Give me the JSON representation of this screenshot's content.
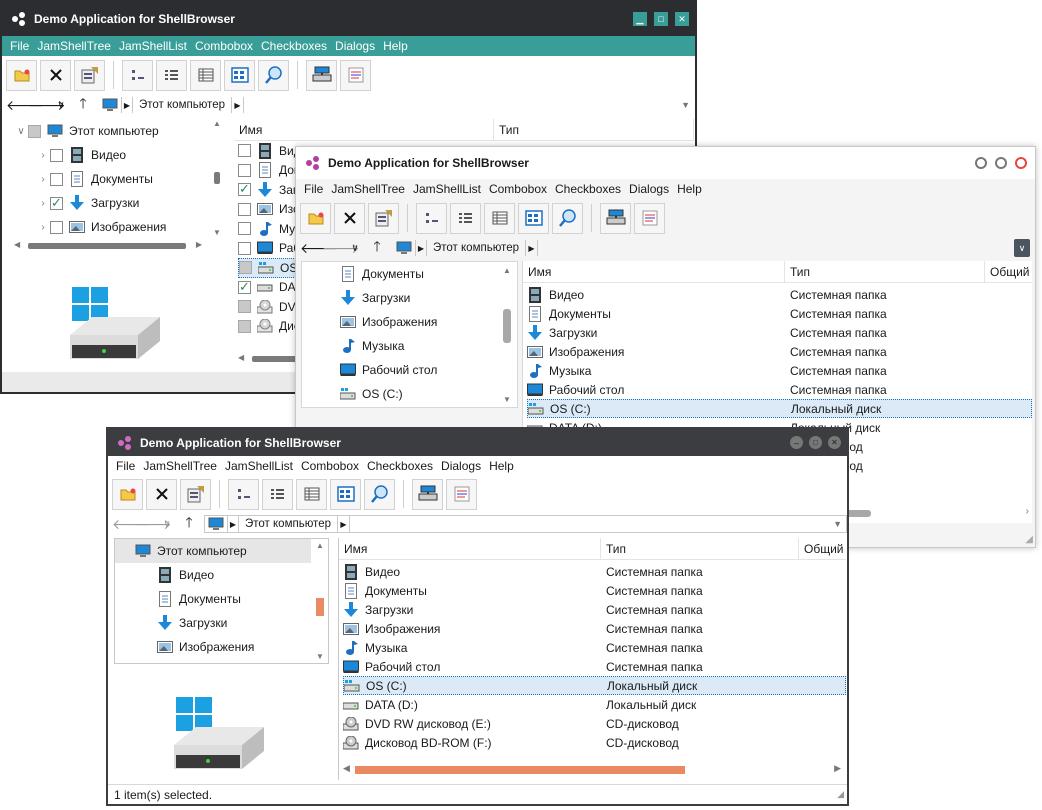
{
  "title": "Demo Application for ShellBrowser",
  "menu": [
    "File",
    "JamShellTree",
    "JamShellList",
    "Combobox",
    "Checkboxes",
    "Dialogs",
    "Help"
  ],
  "address": {
    "location": "Этот компьютер"
  },
  "columns": {
    "name": "Имя",
    "type": "Тип",
    "size": "Общий"
  },
  "tree": {
    "root": "Этот компьютер",
    "items": [
      "Видео",
      "Документы",
      "Загрузки",
      "Изображения",
      "Музыка",
      "Рабочий стол",
      "OS (C:)"
    ]
  },
  "list": {
    "names": [
      "Видео",
      "Документы",
      "Загрузки",
      "Изображения",
      "Музыка",
      "Рабочий стол",
      "OS (C:)",
      "DATA (D:)",
      "DVD RW дисковод (E:)",
      "Дисковод BD-ROM (F:)"
    ],
    "types": [
      "Системная папка",
      "Системная папка",
      "Системная папка",
      "Системная папка",
      "Системная папка",
      "Системная папка",
      "Локальный диск",
      "Локальный диск",
      "CD-дисковод",
      "CD-дисковод"
    ],
    "short_names": [
      "Виде",
      "Доку",
      "Загр",
      "Изоб",
      "Муз",
      "Рабо",
      "OS (",
      "DATA",
      "DVD",
      "Дис"
    ],
    "partial_c": "DATA (D:)",
    "partial_type": "Локальный диск"
  },
  "status": "1 item(s) selected.",
  "themes": {
    "teal": "#3a9e98",
    "dark_window": "#2b2d30",
    "orange_scroll": "#e98a62",
    "close_red": "#e8483a",
    "dark_title": "#3b3d40"
  },
  "icons": {
    "toolbar": [
      "new-folder-icon",
      "delete-icon",
      "properties-icon",
      "small-icons-view-icon",
      "list-view-icon",
      "details-view-icon",
      "tiles-view-icon",
      "search-icon",
      "map-drive-icon",
      "checklist-icon"
    ],
    "nav": [
      "back-icon",
      "forward-icon",
      "dropdown-icon",
      "up-icon"
    ]
  }
}
